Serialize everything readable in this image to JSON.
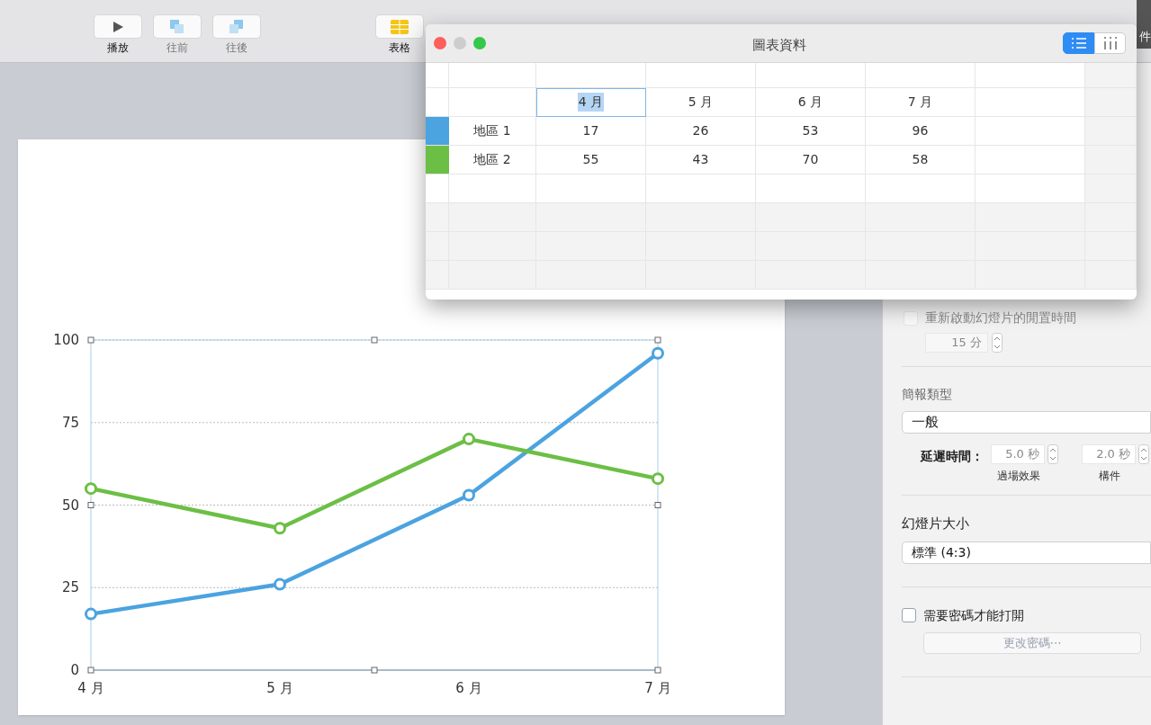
{
  "toolbar": {
    "buttons": [
      {
        "kind": "play",
        "label": "播放",
        "disabled": false
      },
      {
        "kind": "forward",
        "label": "往前",
        "disabled": true
      },
      {
        "kind": "backward",
        "label": "往後",
        "disabled": true
      },
      {
        "kind": "table",
        "label": "表格",
        "disabled": false
      }
    ],
    "right_button": {
      "label": "件"
    }
  },
  "slide": {
    "chart_data": {
      "type": "line",
      "categories": [
        "4 月",
        "5 月",
        "6 月",
        "7 月"
      ],
      "ylim": [
        0,
        100
      ],
      "yticks": [
        0,
        25,
        50,
        75,
        100
      ],
      "grid": true,
      "series": [
        {
          "color": "#4ba3e0",
          "values": [
            17,
            26,
            53,
            96
          ],
          "marker": "circle"
        },
        {
          "color": "#6cbf45",
          "values": [
            55,
            43,
            70,
            58
          ],
          "marker": "circle"
        }
      ]
    }
  },
  "data_window": {
    "title": "圖表資料",
    "view_toggle": [
      {
        "kind": "rows",
        "selected": true
      },
      {
        "kind": "columns",
        "selected": false
      }
    ],
    "columns": [
      {
        "label": "4 月",
        "selected": true
      },
      {
        "label": "5 月",
        "selected": false
      },
      {
        "label": "6 月",
        "selected": false
      },
      {
        "label": "7 月",
        "selected": false
      }
    ],
    "rows": [
      {
        "name": "地區 1",
        "color": "#4ba3e0",
        "values": [
          "17",
          "26",
          "53",
          "96"
        ]
      },
      {
        "name": "地區 2",
        "color": "#6cbf45",
        "values": [
          "55",
          "43",
          "70",
          "58"
        ]
      }
    ]
  },
  "sidebar": {
    "restart_checkbox": {
      "label": "重新啟動幻燈片的閒置時間",
      "checked": false,
      "disabled": true
    },
    "idle_field": {
      "value": "15 分"
    },
    "presentation_type": {
      "label": "簡報類型",
      "value": "一般"
    },
    "delay": {
      "label": "延遲時間：",
      "fields": [
        {
          "value": "5.0 秒",
          "caption": "過場效果"
        },
        {
          "value": "2.0 秒",
          "caption": "構件"
        }
      ]
    },
    "slide_size": {
      "label": "幻燈片大小",
      "value": "標準 (4:3)"
    },
    "password_checkbox": {
      "label": "需要密碼才能打開",
      "checked": false,
      "disabled": false
    },
    "change_password_button": {
      "label": "更改密碼⋯",
      "disabled": true
    }
  }
}
